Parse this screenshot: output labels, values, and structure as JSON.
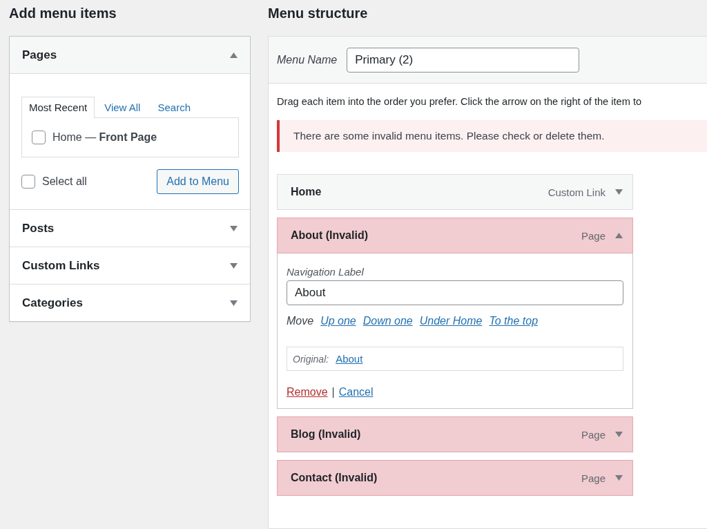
{
  "left": {
    "title": "Add menu items",
    "sections": [
      {
        "title": "Pages",
        "expanded": true,
        "tabs": [
          {
            "label": "Most Recent",
            "selected": true
          },
          {
            "label": "View All",
            "selected": false
          },
          {
            "label": "Search",
            "selected": false
          }
        ],
        "items": [
          {
            "label": "Home — **Front Page**",
            "checked": false
          }
        ],
        "select_all": {
          "label": "Select all",
          "checked": false
        },
        "button": "Add to Menu"
      },
      {
        "title": "Posts",
        "expanded": false
      },
      {
        "title": "Custom Links",
        "expanded": false
      },
      {
        "title": "Categories",
        "expanded": false
      }
    ]
  },
  "right": {
    "title": "Menu structure",
    "menu_name": {
      "label": "Menu Name",
      "value": "Primary (2)"
    },
    "instructions": "Drag each item into the order you prefer. Click the arrow on the right of the item to",
    "notice": "There are some invalid menu items. Please check or delete them.",
    "items": [
      {
        "title": "Home",
        "type": "Custom Link",
        "invalid": false,
        "expanded": false
      },
      {
        "title": "About (Invalid)",
        "type": "Page",
        "invalid": true,
        "expanded": true,
        "settings": {
          "nav_label": {
            "label": "Navigation Label",
            "value": "About"
          },
          "move": {
            "label": "Move",
            "links": [
              "Up one",
              "Down one",
              "Under Home",
              "To the top"
            ]
          },
          "original": {
            "label": "Original:",
            "link": "About"
          },
          "actions": [
            {
              "label": "Remove",
              "kind": "danger"
            },
            {
              "label": "Cancel",
              "kind": "normal"
            }
          ],
          "separator": "|"
        }
      },
      {
        "title": "Blog (Invalid)",
        "type": "Page",
        "invalid": true,
        "expanded": false
      },
      {
        "title": "Contact (Invalid)",
        "type": "Page",
        "invalid": true,
        "expanded": false
      }
    ]
  }
}
